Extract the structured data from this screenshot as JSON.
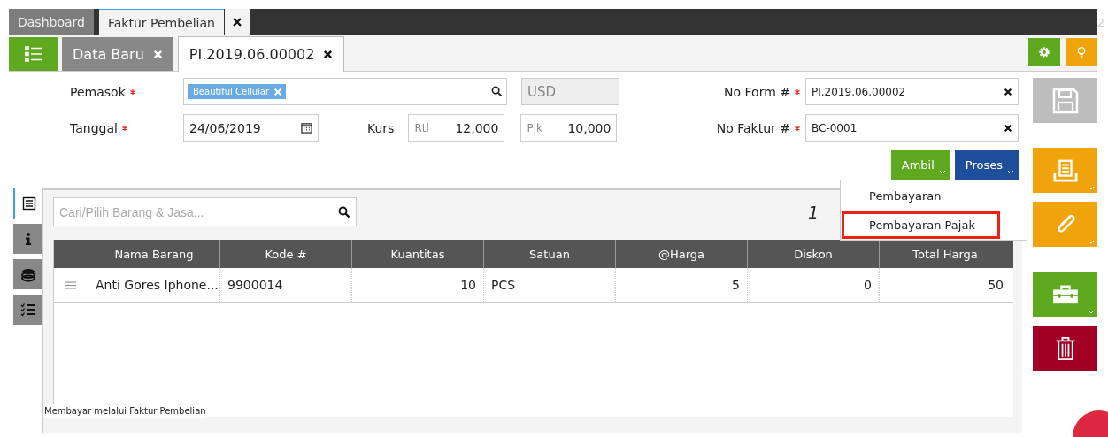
{
  "top_tabs": [
    {
      "label": "Dashboard",
      "selected": false
    },
    {
      "label": "Faktur Pembelian",
      "selected": true
    }
  ],
  "top_bar_edge_text": "2",
  "sub_tabs": [
    {
      "label": "Data Baru",
      "selected": false
    },
    {
      "label": "PI.2019.06.00002",
      "selected": true
    }
  ],
  "form": {
    "supplier": {
      "label": "Pemasok",
      "required": true,
      "tag": "Beautiful Cellular"
    },
    "currency": "USD",
    "date": {
      "label": "Tanggal",
      "required": true,
      "value": "24/06/2019"
    },
    "rate": {
      "label": "Kurs",
      "fields": [
        {
          "prefix": "Rtl",
          "value": "12,000"
        },
        {
          "prefix": "Pjk",
          "value": "10,000"
        }
      ]
    },
    "form_no": {
      "label": "No Form #",
      "required": true,
      "value": "PI.2019.06.00002"
    },
    "invoice_no": {
      "label": "No Faktur #",
      "required": true,
      "value": "BC-0001"
    }
  },
  "action_buttons": [
    {
      "label": "Ambil",
      "color": "#5ea91f"
    },
    {
      "label": "Proses",
      "color": "#1f4e9c"
    }
  ],
  "dropdown_menu": {
    "items": [
      {
        "label": "Pembayaran",
        "highlighted": false
      },
      {
        "label": "Pembayaran Pajak",
        "highlighted": true
      }
    ]
  },
  "side_tabs": [
    {
      "kind": "list",
      "selected": true
    },
    {
      "kind": "info",
      "selected": false
    },
    {
      "kind": "money",
      "selected": false
    },
    {
      "kind": "checklist",
      "selected": false
    }
  ],
  "search": {
    "placeholder": "Cari/Pilih Barang & Jasa..."
  },
  "item_count": "1",
  "table": {
    "columns": [
      "Nama Barang",
      "Kode #",
      "Kuantitas",
      "Satuan",
      "@Harga",
      "Diskon",
      "Total Harga"
    ],
    "rows": [
      {
        "cells": [
          "Anti Gores Iphone...",
          "9900014",
          "10",
          "PCS",
          "5",
          "0",
          "50"
        ]
      }
    ]
  },
  "status_text": "Membayar melalui Faktur Pembelian",
  "side_actions": [
    {
      "kind": "save",
      "disabled": true,
      "dropdown": false
    },
    {
      "kind": "print",
      "disabled": false,
      "dropdown": true
    },
    {
      "kind": "attach",
      "disabled": false,
      "dropdown": true
    },
    {
      "kind": "toolbox",
      "disabled": false,
      "dropdown": true
    },
    {
      "kind": "delete",
      "disabled": false,
      "dropdown": false
    }
  ]
}
